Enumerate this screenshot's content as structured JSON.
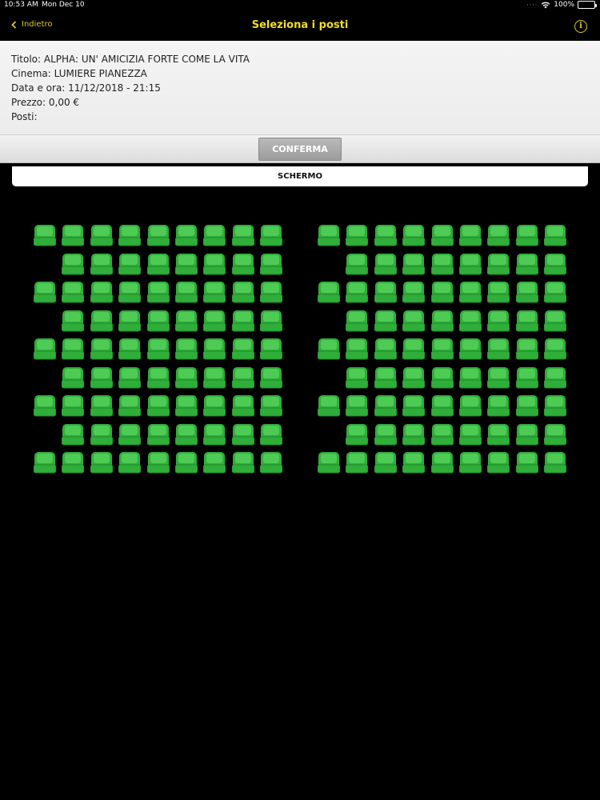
{
  "status": {
    "time": "10:53 AM",
    "date": "Mon Dec 10",
    "battery": "100%"
  },
  "nav": {
    "back_label": "Indietro",
    "title": "Seleziona i posti"
  },
  "details": {
    "titolo": "Titolo: ALPHA: UN' AMICIZIA FORTE COME LA VITA",
    "cinema": "Cinema: LUMIERE PIANEZZA",
    "data_ora": "Data e ora: 11/12/2018 - 21:15",
    "prezzo": "Prezzo: 0,00 €",
    "posti": "Posti:"
  },
  "confirm_label": "CONFERMA",
  "screen_label": "SCHERMO",
  "colors": {
    "accent": "#f2dd2b",
    "seat_available": "#2fae3a",
    "seat_available_light": "#4ecb55"
  },
  "seat_map": {
    "rows": 9,
    "seats_per_block": 9,
    "blocks": 2,
    "rows_without_first_seat": [
      2,
      4,
      6,
      8
    ],
    "status": "available"
  }
}
